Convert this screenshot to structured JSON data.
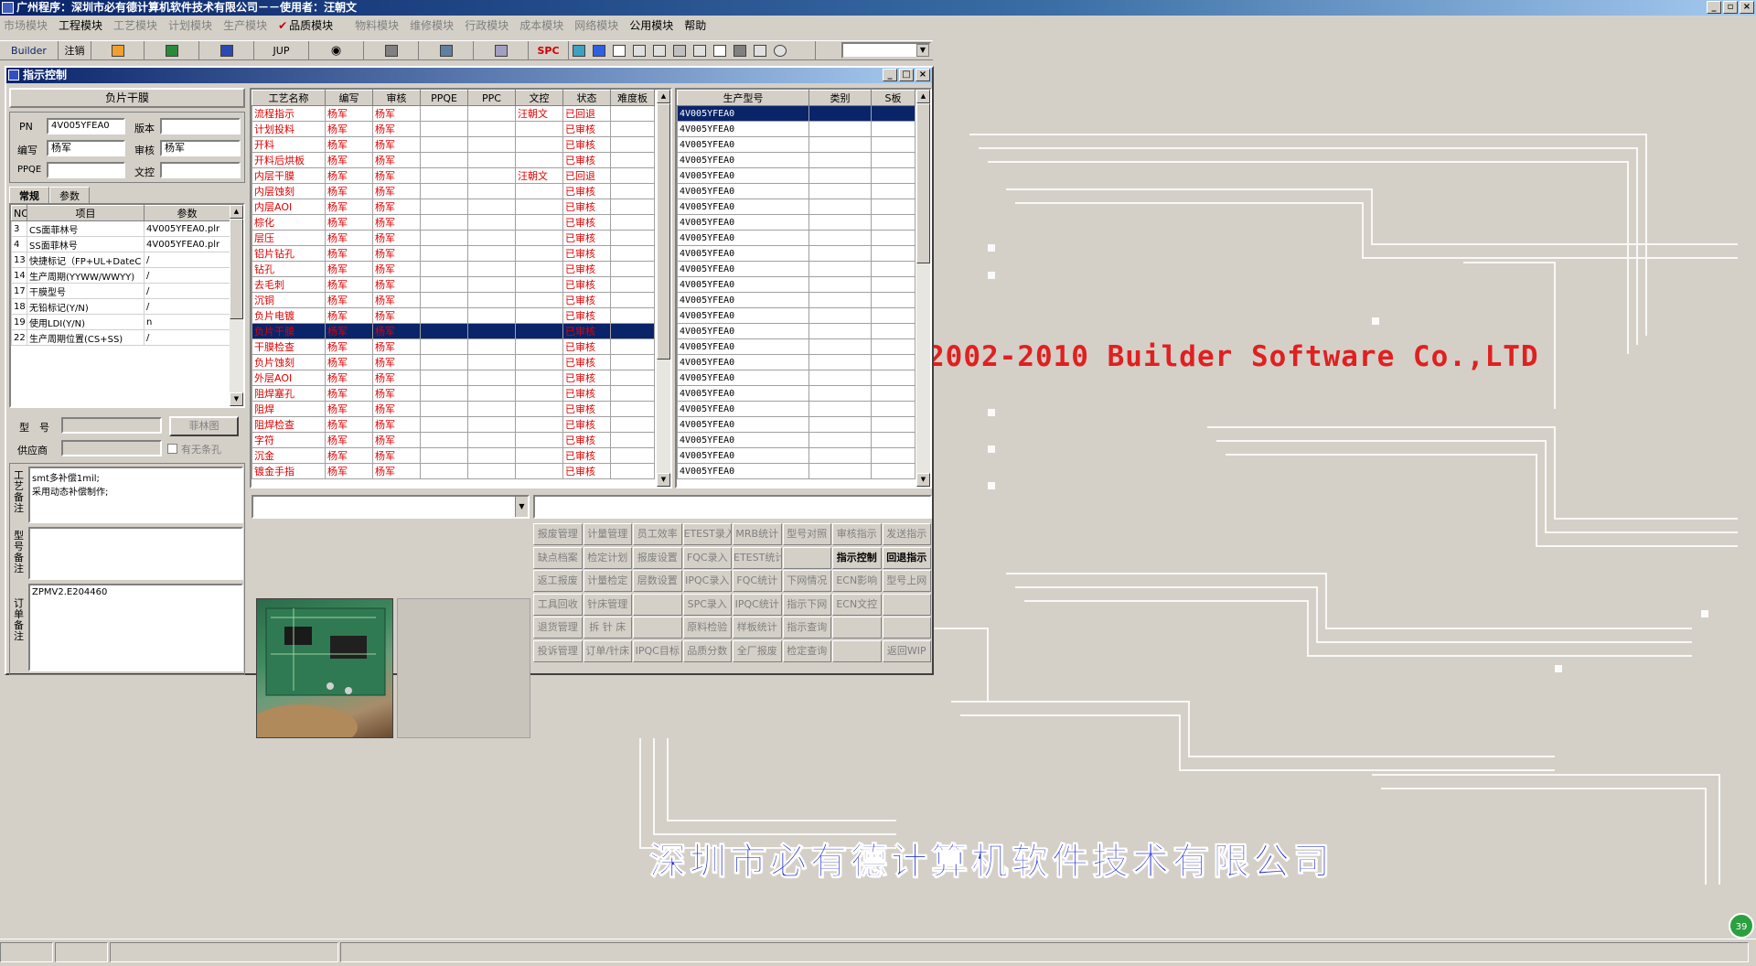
{
  "app": {
    "title": "广州程序：深圳市必有德计算机软件技术有限公司－－使用者：汪朝文"
  },
  "menu": [
    "市场模块",
    "工程模块",
    "工艺模块",
    "计划模块",
    "生产模块",
    "品质模块",
    "物料模块",
    "维修模块",
    "行政模块",
    "成本模块",
    "网络模块",
    "公用模块",
    "帮助"
  ],
  "toolbar": {
    "builder": "Builder",
    "logout": "注销",
    "jup": "JUP",
    "spc": "SPC"
  },
  "window": {
    "title": "指示控制"
  },
  "left": {
    "header": "负片干膜",
    "pn_label": "PN",
    "pn_value": "4V005YFEA0",
    "version_label": "版本",
    "version_value": "",
    "editor_label": "编写",
    "editor_value": "杨军",
    "reviewer_label": "审核",
    "reviewer_value": "杨军",
    "ppqe_label": "PPQE",
    "ppqe_value": "",
    "doc_label": "文控",
    "doc_value": "",
    "tabs": [
      "常规",
      "参数"
    ],
    "items_headers": [
      "NO",
      "项目",
      "参数"
    ],
    "items": [
      {
        "no": "3",
        "item": "CS面菲林号",
        "param": "4V005YFEA0.plr"
      },
      {
        "no": "4",
        "item": "SS面菲林号",
        "param": "4V005YFEA0.plr"
      },
      {
        "no": "13",
        "item": "快捷标记（FP+UL+DateC",
        "param": "/"
      },
      {
        "no": "14",
        "item": "生产周期(YYWW/WWYY)",
        "param": "/"
      },
      {
        "no": "17",
        "item": "干膜型号",
        "param": "/"
      },
      {
        "no": "18",
        "item": "无铅标记(Y/N)",
        "param": "/"
      },
      {
        "no": "19",
        "item": "使用LDI(Y/N)",
        "param": "n"
      },
      {
        "no": "22",
        "item": "生产周期位置(CS+SS)",
        "param": "/"
      }
    ],
    "model_label": "型　号",
    "model_btn": "菲林图",
    "supplier_label": "供应商",
    "no_strip_label": "有无条孔",
    "process_note_label": "工艺备注",
    "process_note": "smt多补偿1mil;\n采用动态补偿制作;",
    "model_note_label": "型号备注",
    "model_note": "",
    "order_note_label": "订单备注",
    "order_note": "ZPMV2.E204460"
  },
  "process": {
    "headers": [
      "工艺名称",
      "编写",
      "审核",
      "PPQE",
      "PPC",
      "文控",
      "状态",
      "难度板"
    ],
    "rows": [
      [
        "流程指示",
        "杨军",
        "杨军",
        "",
        "",
        "汪朝文",
        "已回退",
        ""
      ],
      [
        "计划投料",
        "杨军",
        "杨军",
        "",
        "",
        "",
        "已审核",
        ""
      ],
      [
        "开料",
        "杨军",
        "杨军",
        "",
        "",
        "",
        "已审核",
        ""
      ],
      [
        "开料后烘板",
        "杨军",
        "杨军",
        "",
        "",
        "",
        "已审核",
        ""
      ],
      [
        "内层干膜",
        "杨军",
        "杨军",
        "",
        "",
        "汪朝文",
        "已回退",
        ""
      ],
      [
        "内层蚀刻",
        "杨军",
        "杨军",
        "",
        "",
        "",
        "已审核",
        ""
      ],
      [
        "内层AOI",
        "杨军",
        "杨军",
        "",
        "",
        "",
        "已审核",
        ""
      ],
      [
        "棕化",
        "杨军",
        "杨军",
        "",
        "",
        "",
        "已审核",
        ""
      ],
      [
        "层压",
        "杨军",
        "杨军",
        "",
        "",
        "",
        "已审核",
        ""
      ],
      [
        "铝片钻孔",
        "杨军",
        "杨军",
        "",
        "",
        "",
        "已审核",
        ""
      ],
      [
        "钻孔",
        "杨军",
        "杨军",
        "",
        "",
        "",
        "已审核",
        ""
      ],
      [
        "去毛刺",
        "杨军",
        "杨军",
        "",
        "",
        "",
        "已审核",
        ""
      ],
      [
        "沉铜",
        "杨军",
        "杨军",
        "",
        "",
        "",
        "已审核",
        ""
      ],
      [
        "负片电镀",
        "杨军",
        "杨军",
        "",
        "",
        "",
        "已审核",
        ""
      ],
      [
        "负片干膜",
        "杨军",
        "杨军",
        "",
        "",
        "",
        "已审核",
        ""
      ],
      [
        "干膜检查",
        "杨军",
        "杨军",
        "",
        "",
        "",
        "已审核",
        ""
      ],
      [
        "负片蚀刻",
        "杨军",
        "杨军",
        "",
        "",
        "",
        "已审核",
        ""
      ],
      [
        "外层AOI",
        "杨军",
        "杨军",
        "",
        "",
        "",
        "已审核",
        ""
      ],
      [
        "阻焊塞孔",
        "杨军",
        "杨军",
        "",
        "",
        "",
        "已审核",
        ""
      ],
      [
        "阻焊",
        "杨军",
        "杨军",
        "",
        "",
        "",
        "已审核",
        ""
      ],
      [
        "阻焊检查",
        "杨军",
        "杨军",
        "",
        "",
        "",
        "已审核",
        ""
      ],
      [
        "字符",
        "杨军",
        "杨军",
        "",
        "",
        "",
        "已审核",
        ""
      ],
      [
        "沉金",
        "杨军",
        "杨军",
        "",
        "",
        "",
        "已审核",
        ""
      ],
      [
        "镀金手指",
        "杨军",
        "杨军",
        "",
        "",
        "",
        "已审核",
        ""
      ]
    ],
    "selected": 14
  },
  "models": {
    "headers": [
      "生产型号",
      "类别",
      "S板"
    ],
    "rows": [
      "4V005YFEA0",
      "4V005YFEA0",
      "4V005YFEA0",
      "4V005YFEA0",
      "4V005YFEA0",
      "4V005YFEA0",
      "4V005YFEA0",
      "4V005YFEA0",
      "4V005YFEA0",
      "4V005YFEA0",
      "4V005YFEA0",
      "4V005YFEA0",
      "4V005YFEA0",
      "4V005YFEA0",
      "4V005YFEA0",
      "4V005YFEA0",
      "4V005YFEA0",
      "4V005YFEA0",
      "4V005YFEA0",
      "4V005YFEA0",
      "4V005YFEA0",
      "4V005YFEA0",
      "4V005YFEA0",
      "4V005YFEA0"
    ],
    "selected": 0
  },
  "buttons": [
    [
      "报废管理",
      "计量管理",
      "员工效率",
      "ETEST录入",
      "MRB统计",
      "型号对照",
      "审核指示",
      "发送指示"
    ],
    [
      "缺点档案",
      "检定计划",
      "报废设置",
      "FQC录入",
      "ETEST统计",
      "",
      "指示控制",
      "回退指示"
    ],
    [
      "返工报废",
      "计量检定",
      "层数设置",
      "IPQC录入",
      "FQC统计",
      "下网情况",
      "ECN影响",
      "型号上网"
    ],
    [
      "工具回收",
      "针床管理",
      "",
      "SPC录入",
      "IPQC统计",
      "指示下网",
      "ECN文控",
      ""
    ],
    [
      "退货管理",
      "拆 针 床",
      "",
      "原料检验",
      "样板统计",
      "指示查询",
      "",
      ""
    ],
    [
      "投诉管理",
      "订单/针床",
      "IPQC目标",
      "品质分数",
      "全厂报废",
      "检定查询",
      "",
      "返回WIP"
    ]
  ],
  "active_buttons": [
    "指示控制",
    "回退指示"
  ],
  "brand": "2002-2010 Builder Software Co.,LTD",
  "company": "深圳市必有德计算机软件技术有限公司",
  "badge": "39",
  "colors": {
    "title": "#0a246a",
    "brand_red": "#e02020",
    "company_blue": "#2030d0",
    "status_text": "#e00000"
  }
}
